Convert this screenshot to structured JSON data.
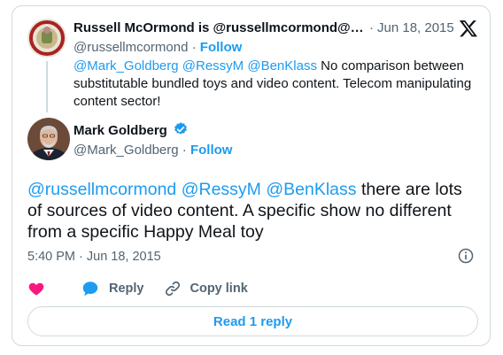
{
  "parent": {
    "name": "Russell McOrmond is @russellmcormond@s…",
    "date": "Jun 18, 2015",
    "handle": "@russellmcormond",
    "follow_label": "Follow",
    "mention1": "@Mark_Goldberg",
    "mention2": "@RessyM",
    "mention3": "@BenKlass",
    "text": "No comparison between substitutable bundled toys and video content. Telecom manipulating content sector!"
  },
  "tweet": {
    "name": "Mark Goldberg",
    "handle": "@Mark_Goldberg",
    "follow_label": "Follow",
    "mention1": "@russellmcormond",
    "mention2": "@RessyM",
    "mention3": "@BenKlass",
    "text": "there are lots of sources of video content. A specific show no different from a specific Happy Meal toy",
    "timestamp": "5:40 PM · Jun 18, 2015"
  },
  "actions": {
    "like_icon": "heart-icon",
    "reply_label": "Reply",
    "copy_link_label": "Copy link"
  },
  "read_reply_label": "Read 1 reply",
  "colors": {
    "link": "#1d9bf0",
    "like": "#f91880",
    "muted": "#536471",
    "border": "#cfd9de"
  }
}
